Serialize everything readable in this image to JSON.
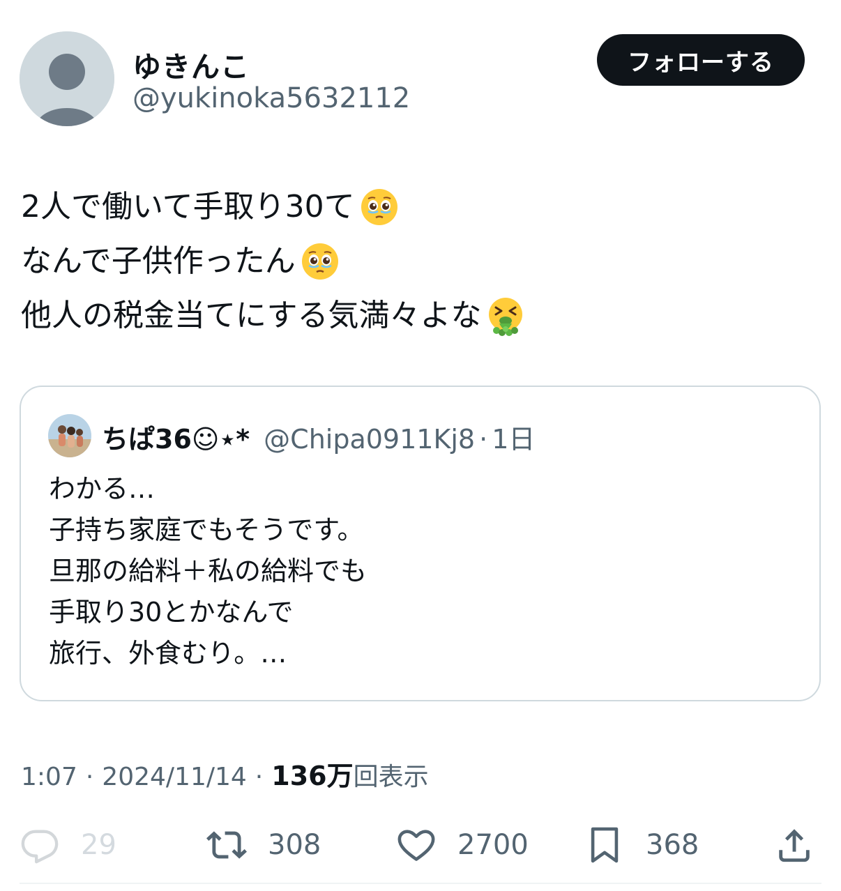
{
  "author": {
    "display_name": "ゆきんこ",
    "handle": "@yukinoka5632112",
    "avatar_icon": "default-avatar-icon"
  },
  "follow_button": {
    "label": "フォローする"
  },
  "tweet": {
    "lines": [
      {
        "text": "2人で働いて手取り30て",
        "emoji": "pleading-face-emoji"
      },
      {
        "text": "なんで子供作ったん",
        "emoji": "pleading-face-emoji"
      },
      {
        "text": "他人の税金当てにする気満々よな",
        "emoji": "vomiting-face-emoji"
      }
    ]
  },
  "quote": {
    "name": "ちぱ36☺︎⋆*",
    "handle": "@Chipa0911Kj8",
    "separator": "·",
    "time": "1日",
    "lines": [
      "わかる…",
      "子持ち家庭でもそうです。",
      "旦那の給料＋私の給料でも",
      "手取り30とかなんで",
      "旅行、外食むり。…"
    ]
  },
  "meta": {
    "time": "1:07",
    "separator": "·",
    "date": "2024/11/14",
    "views_count": "136万",
    "views_label": "回表示"
  },
  "actions": {
    "reply": {
      "icon": "reply-icon",
      "count": "29"
    },
    "retweet": {
      "icon": "retweet-icon",
      "count": "308"
    },
    "like": {
      "icon": "heart-icon",
      "count": "2700"
    },
    "bookmark": {
      "icon": "bookmark-icon",
      "count": "368"
    },
    "share": {
      "icon": "share-icon"
    }
  },
  "colors": {
    "text": "#0f1419",
    "secondary": "#536471",
    "border": "#cfd9de",
    "button_bg": "#0f1419"
  }
}
